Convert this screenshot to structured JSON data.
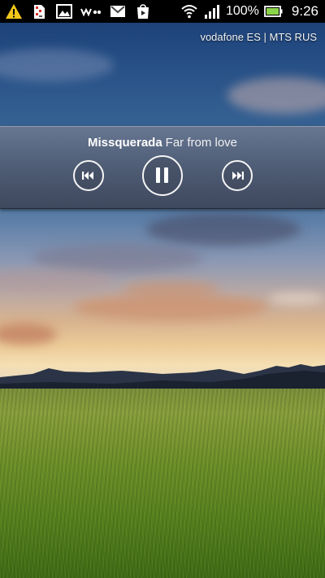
{
  "status_bar": {
    "notification_icons": [
      "warning-icon",
      "sim-card-icon",
      "gallery-icon",
      "walkman-icon",
      "gmail-icon",
      "play-store-icon"
    ],
    "wifi_icon": "wifi-icon",
    "signal_icon": "signal-icon",
    "battery_percent": "100%",
    "battery_icon": "battery-charging-icon",
    "time": "9:26"
  },
  "carrier": "vodafone ES | MTS RUS",
  "music_widget": {
    "artist": "Missquerada",
    "title": "Far from love",
    "prev_icon": "previous-track-icon",
    "play_pause_icon": "pause-icon",
    "next_icon": "next-track-icon"
  },
  "colors": {
    "status_bar_bg": "#000000",
    "widget_bg": "#5e6a84",
    "widget_text": "#ffffff"
  }
}
